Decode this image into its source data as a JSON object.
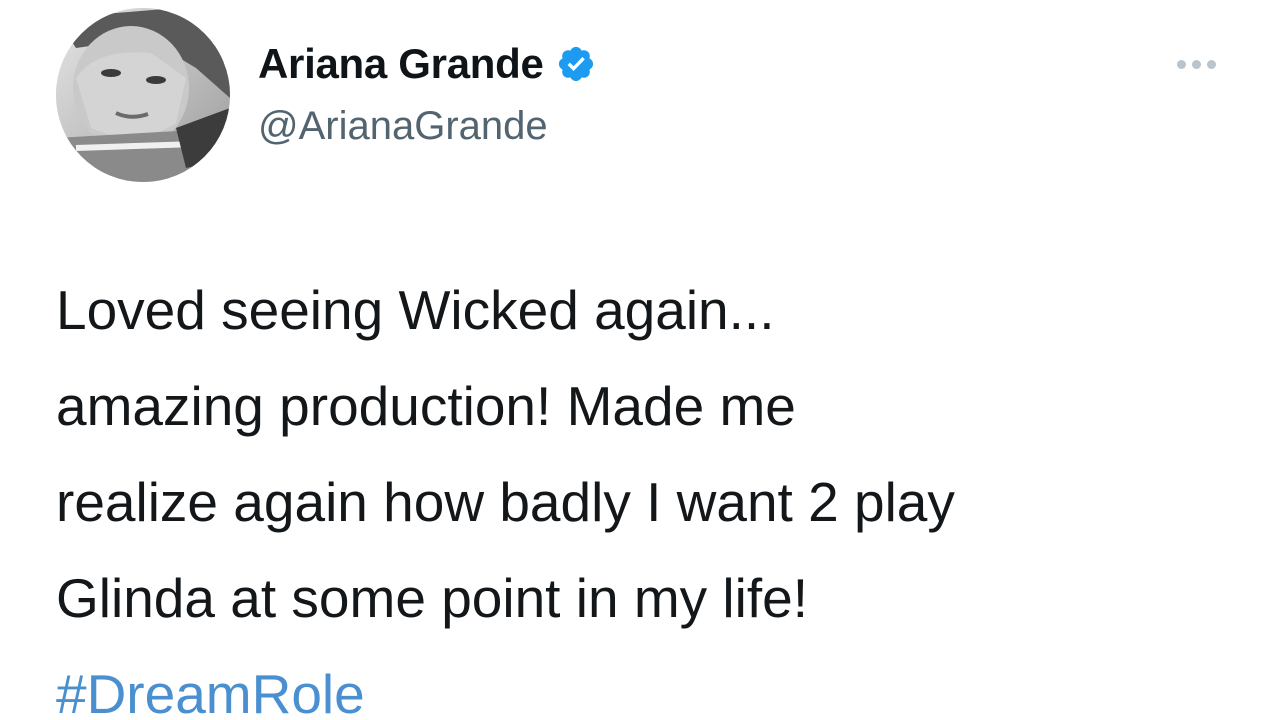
{
  "tweet": {
    "author": {
      "display_name": "Ariana Grande",
      "handle": "@ArianaGrande",
      "verified": true,
      "avatar_icon": "profile-photo",
      "verified_color": "#1d9bf0"
    },
    "more_icon": "more-options-icon",
    "text_lines": [
      "Loved seeing Wicked again...",
      "amazing production! Made me",
      "realize again how badly I want 2 play",
      "Glinda at some point in my life!"
    ],
    "hashtag": "#DreamRole",
    "hashtag_color": "#4a90d0"
  }
}
